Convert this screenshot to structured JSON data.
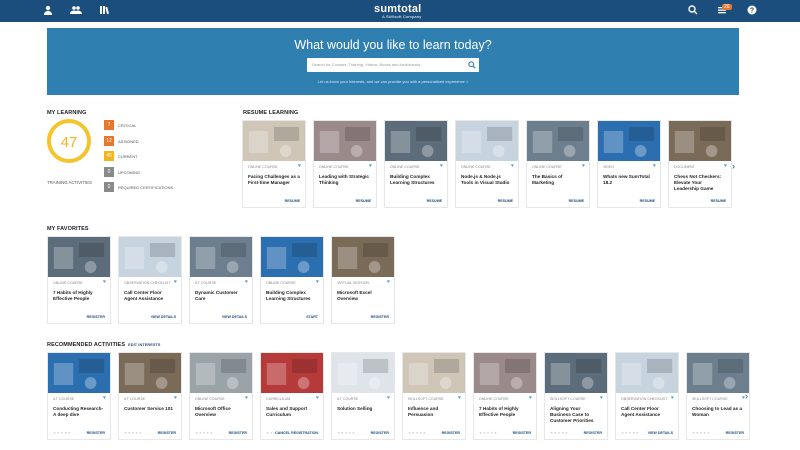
{
  "brand": {
    "logo": "sumtotal",
    "tagline": "A Skillsoft Company"
  },
  "topbar": {
    "notif_count": "26"
  },
  "hero": {
    "headline": "What would you like to learn today?",
    "search_placeholder": "Search for Courses, Training, Videos, Books and Audiobooks",
    "note": "Let us know your Interests, and we can provide you with a personalized experience >"
  },
  "my_learning": {
    "title": "MY LEARNING",
    "total": "47",
    "total_label": "TRAINING ACTIVITIES",
    "stats": [
      {
        "count": "7",
        "label": "CRITICAL",
        "color": "#e8772e"
      },
      {
        "count": "12",
        "label": "ASSIGNED",
        "color": "#e8772e"
      },
      {
        "count": "46",
        "label": "CURRENT",
        "color": "#f2b51d"
      },
      {
        "count": "0",
        "label": "UPCOMING",
        "color": "#8a8a8a"
      },
      {
        "count": "0",
        "label": "REQUIRED CERTIFICATIONS",
        "color": "#8a8a8a"
      }
    ]
  },
  "resume": {
    "title": "RESUME LEARNING",
    "cards": [
      {
        "type": "ONLINE COURSE",
        "title": "Facing Challenges as a First-time Manager",
        "action": "RESUME"
      },
      {
        "type": "ONLINE COURSE",
        "title": "Leading with Strategic Thinking",
        "action": "RESUME"
      },
      {
        "type": "ONLINE COURSE",
        "title": "Building Complex Learning Structures",
        "action": "RESUME"
      },
      {
        "type": "ONLINE COURSE",
        "title": "Node.js & Node.js Tools in Visual Studio",
        "action": "RESUME"
      },
      {
        "type": "ONLINE COURSE",
        "title": "The Basics of Marketing",
        "action": "RESUME"
      },
      {
        "type": "VIDEO",
        "title": "Whats new SumTotal 18.2",
        "action": "RESUME"
      },
      {
        "type": "DOCUMENT",
        "title": "Chess Not Checkers: Elevate Your Leadership Game",
        "action": "RESUME"
      }
    ]
  },
  "favorites": {
    "title": "MY FAVORITES",
    "cards": [
      {
        "type": "ONLINE COURSE",
        "title": "7 Habits of Highly Effective People",
        "action": "REGISTER"
      },
      {
        "type": "OBSERVATION CHECKLIST",
        "title": "Call Center Floor Agent Assistance",
        "action": "VIEW DETAILS"
      },
      {
        "type": "ILT COURSE",
        "title": "Dynamic Customer Care",
        "action": "VIEW DETAILS"
      },
      {
        "type": "ONLINE COURSE",
        "title": "Building Complex Learning Structures",
        "action": "START"
      },
      {
        "type": "VIRTUAL SESSION",
        "title": "Microsoft Excel Overview",
        "action": "REGISTER"
      }
    ]
  },
  "recommended": {
    "title": "RECOMMENDED ACTIVITIES",
    "edit_link": "EDIT INTERESTS",
    "cards": [
      {
        "type": "ILT COURSE",
        "title": "Conducting Research-A deep dive",
        "action": "REGISTER"
      },
      {
        "type": "ILT COURSE",
        "title": "Customer Service 101",
        "action": "REGISTER"
      },
      {
        "type": "ONLINE COURSE",
        "title": "Microsoft Office Overview",
        "action": "REGISTER"
      },
      {
        "type": "CURRICULUM",
        "title": "Sales and Support Curriculum",
        "action": "CANCEL REGISTRATION"
      },
      {
        "type": "ILT COURSE",
        "title": "Solution Selling",
        "action": "REGISTER"
      },
      {
        "type": "SKILLSOFT COURSE",
        "title": "Influence and Persuasion",
        "action": "REGISTER"
      },
      {
        "type": "ONLINE COURSE",
        "title": "7 Habits of Highly Effective People",
        "action": "REGISTER"
      },
      {
        "type": "SKILLSOFT COURSE",
        "title": "Aligning Your Business Case to Customer Priorities",
        "action": "REGISTER"
      },
      {
        "type": "OBSERVATION CHECKLIST",
        "title": "Call Center Floor Agent Assistance",
        "action": "VIEW DETAILS"
      },
      {
        "type": "SKILLSOFT COURSE",
        "title": "Choosing to Lead as a Woman",
        "action": "REGISTER"
      }
    ]
  }
}
